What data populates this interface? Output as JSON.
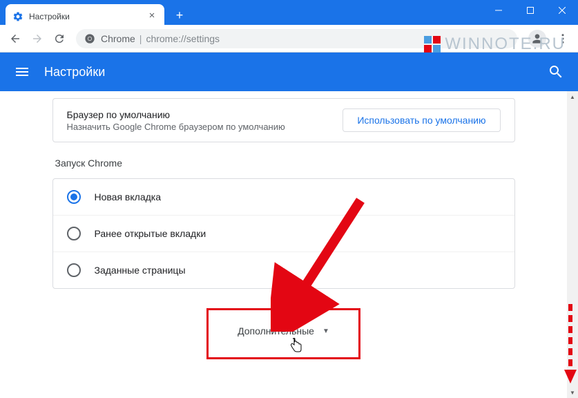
{
  "window": {
    "tab_title": "Настройки"
  },
  "toolbar": {
    "omnibox_origin": "Chrome",
    "omnibox_path": "chrome://settings"
  },
  "header": {
    "title": "Настройки"
  },
  "default_browser": {
    "title": "Браузер по умолчанию",
    "subtitle": "Назначить Google Chrome браузером по умолчанию",
    "button": "Использовать по умолчанию"
  },
  "startup": {
    "section_label": "Запуск Chrome",
    "options": [
      {
        "label": "Новая вкладка",
        "checked": true
      },
      {
        "label": "Ранее открытые вкладки",
        "checked": false
      },
      {
        "label": "Заданные страницы",
        "checked": false
      }
    ]
  },
  "advanced": {
    "label": "Дополнительные"
  },
  "watermark": {
    "text": "WINNOTE.RU"
  }
}
